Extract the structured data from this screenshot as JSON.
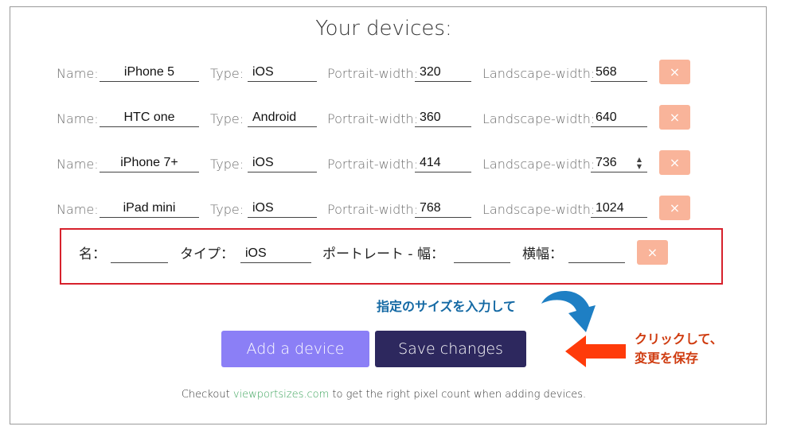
{
  "title": "Your devices:",
  "labels": {
    "name": "Name:",
    "type": "Type:",
    "portrait": "Portrait-width:",
    "landscape": "Landscape-width:"
  },
  "remove_label": "×",
  "devices": [
    {
      "name": "iPhone 5",
      "type": "iOS",
      "portrait": "320",
      "landscape": "568"
    },
    {
      "name": "HTC one",
      "type": "Android",
      "portrait": "360",
      "landscape": "640"
    },
    {
      "name": "iPhone 7+",
      "type": "iOS",
      "portrait": "414",
      "landscape": "736"
    },
    {
      "name": "iPad mini",
      "type": "iOS",
      "portrait": "768",
      "landscape": "1024"
    }
  ],
  "new_device": {
    "name_label": "名：",
    "type_label": "タイプ：",
    "portrait_label": "ポートレート - 幅：",
    "landscape_label": "横幅：",
    "name": "",
    "type": "iOS",
    "portrait": "",
    "landscape": ""
  },
  "hint_text": "指定のサイズを入力して",
  "buttons": {
    "add": "Add a device",
    "save": "Save changes"
  },
  "note": {
    "line1": "クリックして、",
    "line2": "変更を保存"
  },
  "footer": {
    "before": "Checkout ",
    "link": "viewportsizes.com",
    "after": " to get the right pixel count when adding devices."
  },
  "colors": {
    "add_button": "#8b7ff6",
    "save_button": "#2d285e",
    "remove_button": "#f9b49a",
    "highlight": "#d7212c",
    "hint": "#1469a4",
    "note": "#cf3b0f",
    "link": "#3aa35a"
  }
}
